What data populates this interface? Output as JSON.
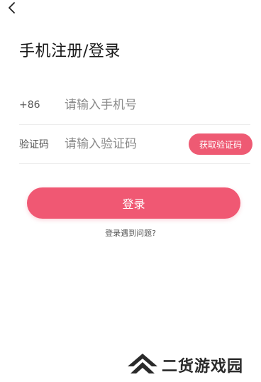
{
  "header": {
    "back_icon": "chevron-left-icon",
    "title": "手机注册/登录"
  },
  "form": {
    "phone": {
      "prefix": "+86",
      "value": "",
      "placeholder": "请输入手机号"
    },
    "code": {
      "label": "验证码",
      "value": "",
      "placeholder": "请输入验证码",
      "get_code_label": "获取验证码"
    }
  },
  "actions": {
    "login_label": "登录",
    "help_label": "登录遇到问题?"
  },
  "watermark": {
    "text": "二货游戏园"
  },
  "colors": {
    "accent": "#f05873",
    "accent_small": "#ee5a73",
    "background": "#ffffff"
  }
}
